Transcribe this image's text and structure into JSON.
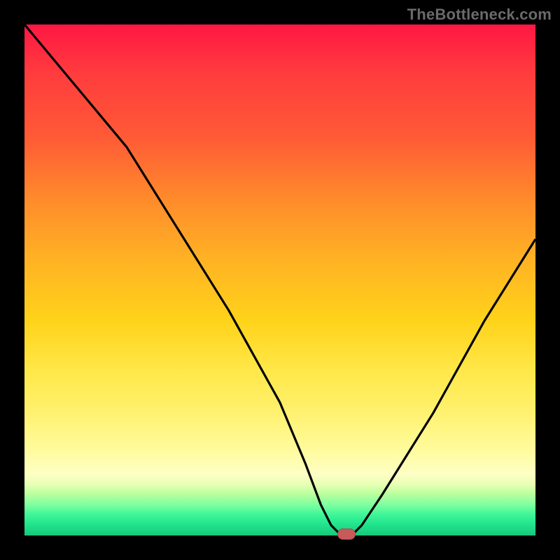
{
  "attribution": "TheBottleneck.com",
  "colors": {
    "bg": "#000000",
    "curve": "#000000",
    "marker": "#c85a5a"
  },
  "chart_data": {
    "type": "line",
    "title": "",
    "xlabel": "",
    "ylabel": "",
    "xlim": [
      0,
      100
    ],
    "ylim": [
      0,
      100
    ],
    "series": [
      {
        "name": "bottleneck-curve",
        "x": [
          0,
          10,
          20,
          30,
          40,
          50,
          55,
          58,
          60,
          62,
          64,
          66,
          70,
          80,
          90,
          100
        ],
        "y": [
          100,
          88,
          76,
          60,
          44,
          26,
          14,
          6,
          2,
          0,
          0,
          2,
          8,
          24,
          42,
          58
        ]
      }
    ],
    "marker": {
      "x": 63,
      "y": 0
    },
    "annotations": []
  }
}
